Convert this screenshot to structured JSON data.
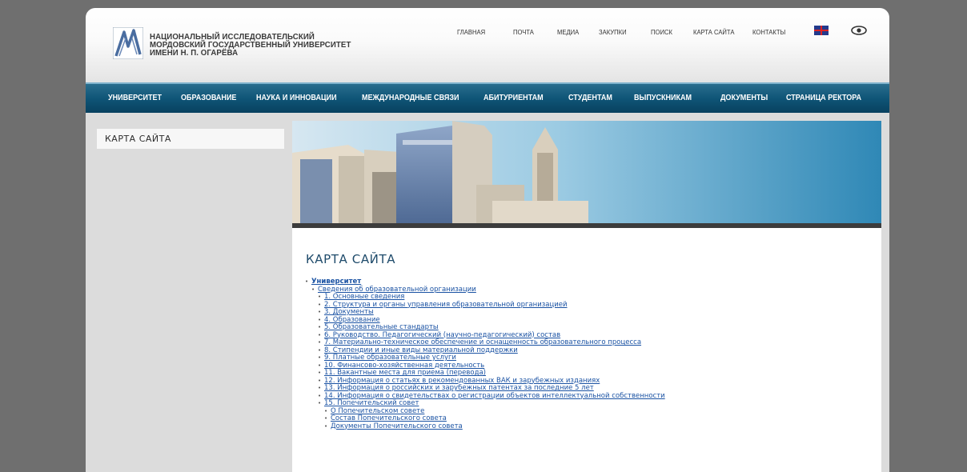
{
  "header": {
    "logo_lines": [
      "НАЦИОНАЛЬНЫЙ ИССЛЕДОВАТЕЛЬСКИЙ",
      "МОРДОВСКИЙ ГОСУДАРСТВЕННЫЙ УНИВЕРСИТЕТ",
      "ИМЕНИ Н. П. ОГАРЁВА"
    ],
    "top_links": [
      "ГЛАВНАЯ",
      "ПОЧТА",
      "МЕДИА",
      "ЗАКУПКИ",
      "ПОИСК",
      "КАРТА САЙТА",
      "КОНТАКТЫ"
    ],
    "language_icon": "uk-flag-icon",
    "accessibility_icon": "eye-icon"
  },
  "nav": {
    "items": [
      "УНИВЕРСИТЕТ",
      "ОБРАЗОВАНИЕ",
      "НАУКА И ИННОВАЦИИ",
      "МЕЖДУНАРОДНЫЕ СВЯЗИ",
      "АБИТУРИЕНТАМ",
      "СТУДЕНТАМ",
      "ВЫПУСКНИКАМ",
      "ДОКУМЕНТЫ",
      "СТРАНИЦА РЕКТОРА"
    ]
  },
  "sidebar": {
    "title": "КАРТА САЙТА"
  },
  "main": {
    "title": "КАРТА САЙТА",
    "tree": [
      {
        "level": 1,
        "text": "Университет",
        "bold": true
      },
      {
        "level": 2,
        "text": "Сведения об образовательной организации"
      },
      {
        "level": 3,
        "text": "1. Основные сведения"
      },
      {
        "level": 3,
        "text": "2. Структура и органы управления образовательной организацией"
      },
      {
        "level": 3,
        "text": "3. Документы"
      },
      {
        "level": 3,
        "text": "4. Образование"
      },
      {
        "level": 3,
        "text": "5. Образовательные стандарты"
      },
      {
        "level": 3,
        "text": "6. Руководство. Педагогический (научно-педагогический) состав"
      },
      {
        "level": 3,
        "text": "7. Материально-техническое обеспечение и оснащенность образовательного процесса"
      },
      {
        "level": 3,
        "text": "8. Стипендии и иные виды материальной поддержки"
      },
      {
        "level": 3,
        "text": "9. Платные образовательные услуги"
      },
      {
        "level": 3,
        "text": "10. Финансово-хозяйственная деятельность"
      },
      {
        "level": 3,
        "text": "11. Вакантные места для приема (перевода)"
      },
      {
        "level": 3,
        "text": "12. Информация о статьях в рекомендованных ВАК и зарубежных изданиях"
      },
      {
        "level": 3,
        "text": "13. Информация о российских и зарубежных патентах за последние 5 лет"
      },
      {
        "level": 3,
        "text": "14. Информация о свидетельствах о регистрации объектов интеллектуальной собственности"
      },
      {
        "level": 3,
        "text": "15. Попечительский совет"
      },
      {
        "level": 4,
        "text": "О Попечительском совете"
      },
      {
        "level": 4,
        "text": "Состав Попечительского совета"
      },
      {
        "level": 4,
        "text": "Документы Попечительского совета"
      }
    ]
  }
}
